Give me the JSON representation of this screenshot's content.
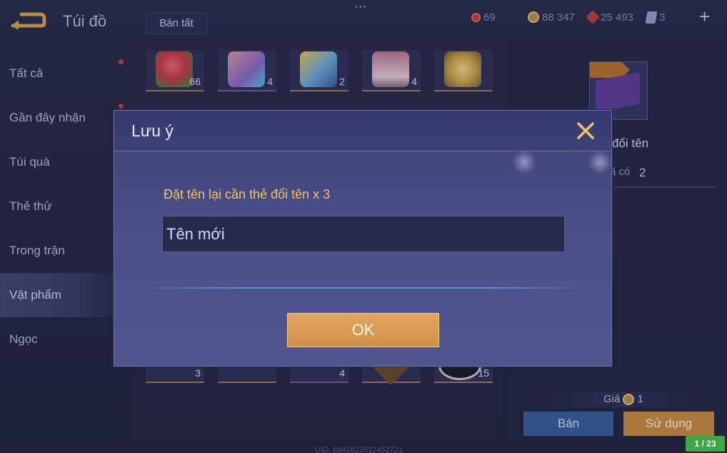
{
  "header": {
    "title": "Túi đồ",
    "sell_all_label": "Bán tất",
    "currencies": [
      {
        "icon": "red-coin-icon",
        "value": "69"
      },
      {
        "icon": "gold-coin-icon",
        "value": "88 347"
      },
      {
        "icon": "red-gem-icon",
        "value": "25 493"
      },
      {
        "icon": "card-icon",
        "value": "3"
      }
    ]
  },
  "sidebar": {
    "items": [
      {
        "label": "Tất cả"
      },
      {
        "label": "Gần đây nhận"
      },
      {
        "label": "Túi quà"
      },
      {
        "label": "Thẻ thử"
      },
      {
        "label": "Trong trận"
      },
      {
        "label": "Vật phẩm"
      },
      {
        "label": "Ngọc"
      }
    ]
  },
  "grid": {
    "top_row_counts": [
      "66",
      "4",
      "2",
      "4",
      ""
    ],
    "bottom_row_counts": [
      "3",
      "",
      "4",
      "",
      "15"
    ]
  },
  "detail": {
    "name_partial": "đổi tên",
    "have_label": "ã có",
    "have_count": "2",
    "price_label": "Giá",
    "price_value": "1",
    "sell_label": "Bán",
    "use_label": "Sử dụng"
  },
  "footer": {
    "uid": "UID: 6941622512452721",
    "page_counter": "1 / 23"
  },
  "modal": {
    "title": "Lưu ý",
    "message": "Đặt tên lại cần thẻ đổi tên x 3",
    "input_placeholder": "Tên mới",
    "ok_label": "OK"
  },
  "colors": {
    "accent_gold": "#f0c36a",
    "button_ok": "#d9994f",
    "button_sell": "#3c5d9c",
    "button_use": "#c58c44",
    "page_counter_bg": "#3aa843"
  }
}
